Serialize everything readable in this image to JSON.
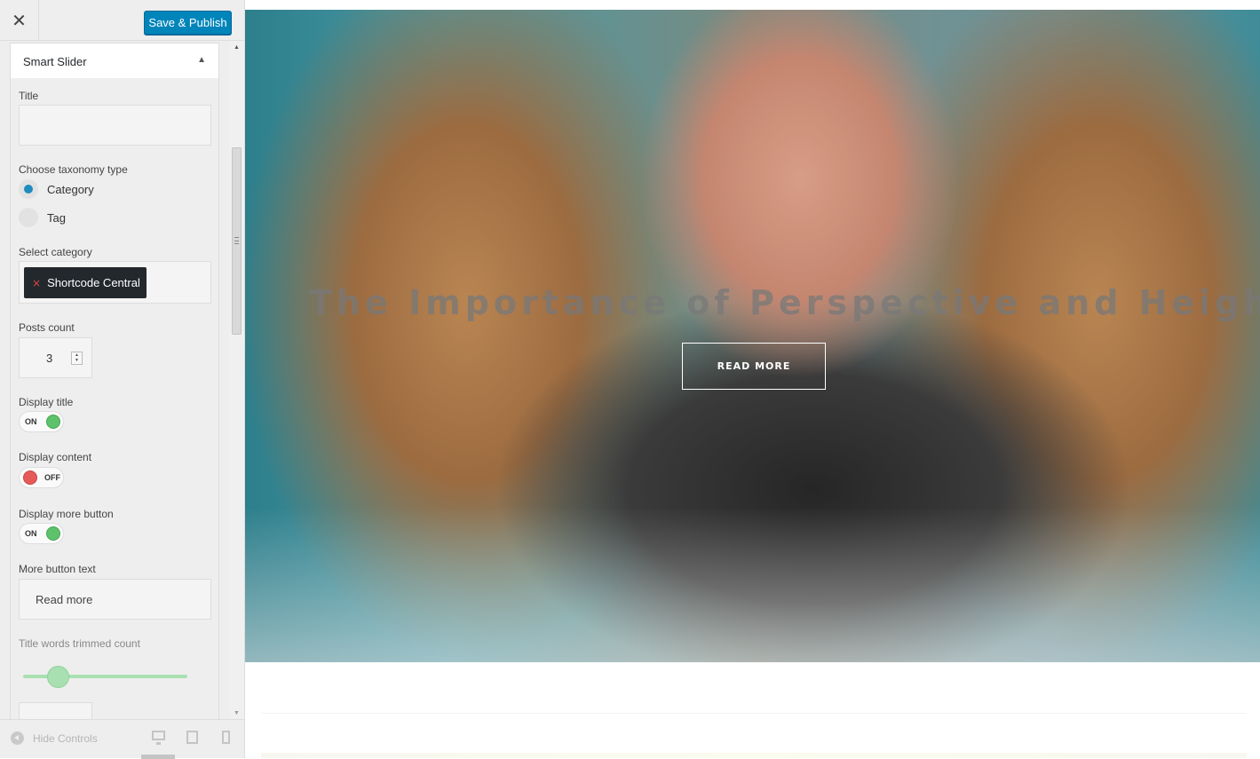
{
  "header": {
    "close_glyph": "✕",
    "publish_label": "Save & Publish"
  },
  "section": {
    "title": "Smart Slider",
    "collapse_glyph": "▲"
  },
  "fields": {
    "title_label": "Title",
    "title_value": "",
    "taxonomy_label": "Choose taxonomy type",
    "taxonomy_options": [
      {
        "label": "Category",
        "selected": true
      },
      {
        "label": "Tag",
        "selected": false
      }
    ],
    "category_label": "Select category",
    "category_chip": "Shortcode Central",
    "chip_remove_glyph": "×",
    "posts_count_label": "Posts count",
    "posts_count_value": "3",
    "display_title_label": "Display title",
    "display_title_state": "ON",
    "display_content_label": "Display content",
    "display_content_state": "OFF",
    "display_more_label": "Display more button",
    "display_more_state": "ON",
    "more_text_label": "More button text",
    "more_text_value": "Read more",
    "trim_label": "Title words trimmed count",
    "trim_fraction": 0.21
  },
  "footer": {
    "hide_controls_label": "Hide Controls",
    "devices": [
      "desktop-icon",
      "tablet-icon",
      "mobile-icon"
    ]
  },
  "preview": {
    "slide_title": "The Importance of Perspective and Height",
    "button_label": "READ MORE"
  },
  "colors": {
    "accent": "#0085ba",
    "toggle_on": "#5dc26a",
    "toggle_off": "#e65a5a",
    "radio_selected": "#1e8cbe",
    "slider": "#a8e0b1"
  }
}
